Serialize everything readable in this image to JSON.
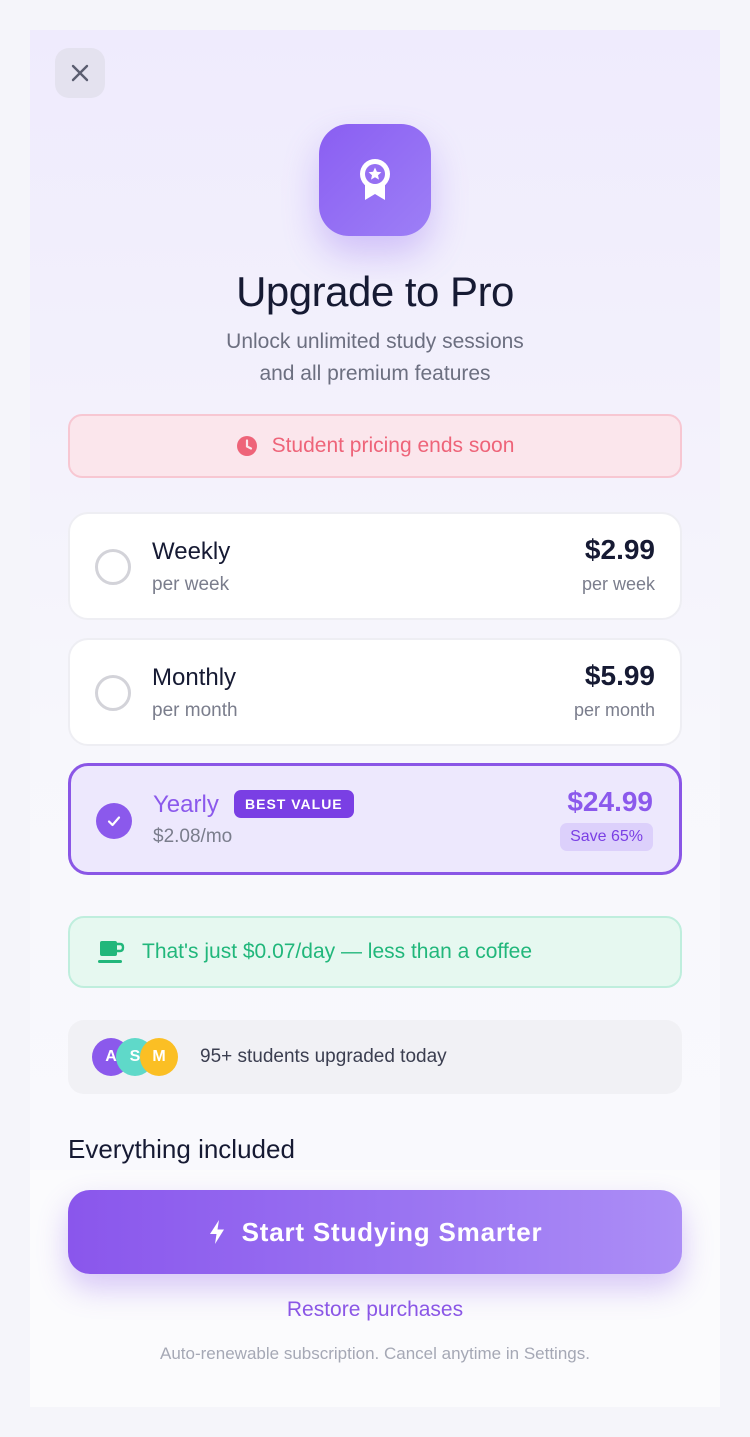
{
  "header": {
    "close_icon": "close-icon",
    "hero_icon": "award-badge-icon",
    "title": "Upgrade to Pro",
    "subtitle_line1": "Unlock unlimited study sessions",
    "subtitle_line2": "and all premium features"
  },
  "urgency": {
    "icon": "clock-icon",
    "text": "Student pricing ends soon"
  },
  "plans": [
    {
      "name": "Weekly",
      "sub": "per week",
      "price": "$2.99",
      "per": "per week",
      "selected": false
    },
    {
      "name": "Monthly",
      "sub": "per month",
      "price": "$5.99",
      "per": "per month",
      "selected": false
    },
    {
      "name": "Yearly",
      "badge": "BEST VALUE",
      "sub": "$2.08/mo",
      "price": "$24.99",
      "save": "Save 65%",
      "selected": true
    }
  ],
  "coffee": {
    "icon": "coffee-cup-icon",
    "text": "That's just $0.07/day — less than a coffee"
  },
  "social": {
    "avatars": [
      {
        "initial": "A",
        "color": "#8b59ec"
      },
      {
        "initial": "S",
        "color": "#5fd9c9"
      },
      {
        "initial": "M",
        "color": "#fbbf24"
      }
    ],
    "text": "95+ students upgraded today"
  },
  "included_heading": "Everything included",
  "cta": {
    "icon": "lightning-icon",
    "label": "Start Studying Smarter"
  },
  "restore_label": "Restore purchases",
  "legal": "Auto-renewable subscription. Cancel anytime in Settings.",
  "colors": {
    "accent": "#8b59ec",
    "urgency": "#ee6479",
    "success": "#21b77b"
  }
}
